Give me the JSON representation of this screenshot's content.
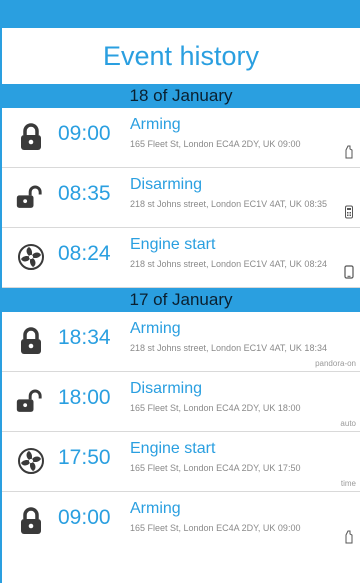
{
  "title": "Event history",
  "colors": {
    "accent": "#2a9fe0",
    "icon": "#3a3a3a"
  },
  "groups": [
    {
      "date": "18 of January",
      "events": [
        {
          "icon": "lock-closed-icon",
          "time": "09:00",
          "type": "Arming",
          "address": "165 Fleet St, London EC4A 2DY, UK 09:00",
          "source_icon": "key-fob-icon",
          "source_text": ""
        },
        {
          "icon": "lock-open-icon",
          "time": "08:35",
          "type": "Disarming",
          "address": "218 st Johns street, London EC1V 4AT, UK 08:35",
          "source_icon": "remote-icon",
          "source_text": ""
        },
        {
          "icon": "engine-fan-icon",
          "time": "08:24",
          "type": "Engine start",
          "address": "218 st Johns street, London EC1V 4AT, UK 08:24",
          "source_icon": "smartphone-icon",
          "source_text": ""
        }
      ]
    },
    {
      "date": "17 of January",
      "events": [
        {
          "icon": "lock-closed-icon",
          "time": "18:34",
          "type": "Arming",
          "address": "218 st Johns street, London EC1V 4AT, UK 18:34",
          "source_icon": "",
          "source_text": "pandora-on"
        },
        {
          "icon": "lock-open-icon",
          "time": "18:00",
          "type": "Disarming",
          "address": "165 Fleet St, London EC4A 2DY, UK 18:00",
          "source_icon": "",
          "source_text": "auto"
        },
        {
          "icon": "engine-fan-icon",
          "time": "17:50",
          "type": "Engine start",
          "address": "165 Fleet St, London EC4A 2DY, UK 17:50",
          "source_icon": "",
          "source_text": "time"
        },
        {
          "icon": "lock-closed-icon",
          "time": "09:00",
          "type": "Arming",
          "address": "165 Fleet St, London EC4A 2DY, UK 09:00",
          "source_icon": "key-fob-icon",
          "source_text": ""
        }
      ]
    }
  ]
}
